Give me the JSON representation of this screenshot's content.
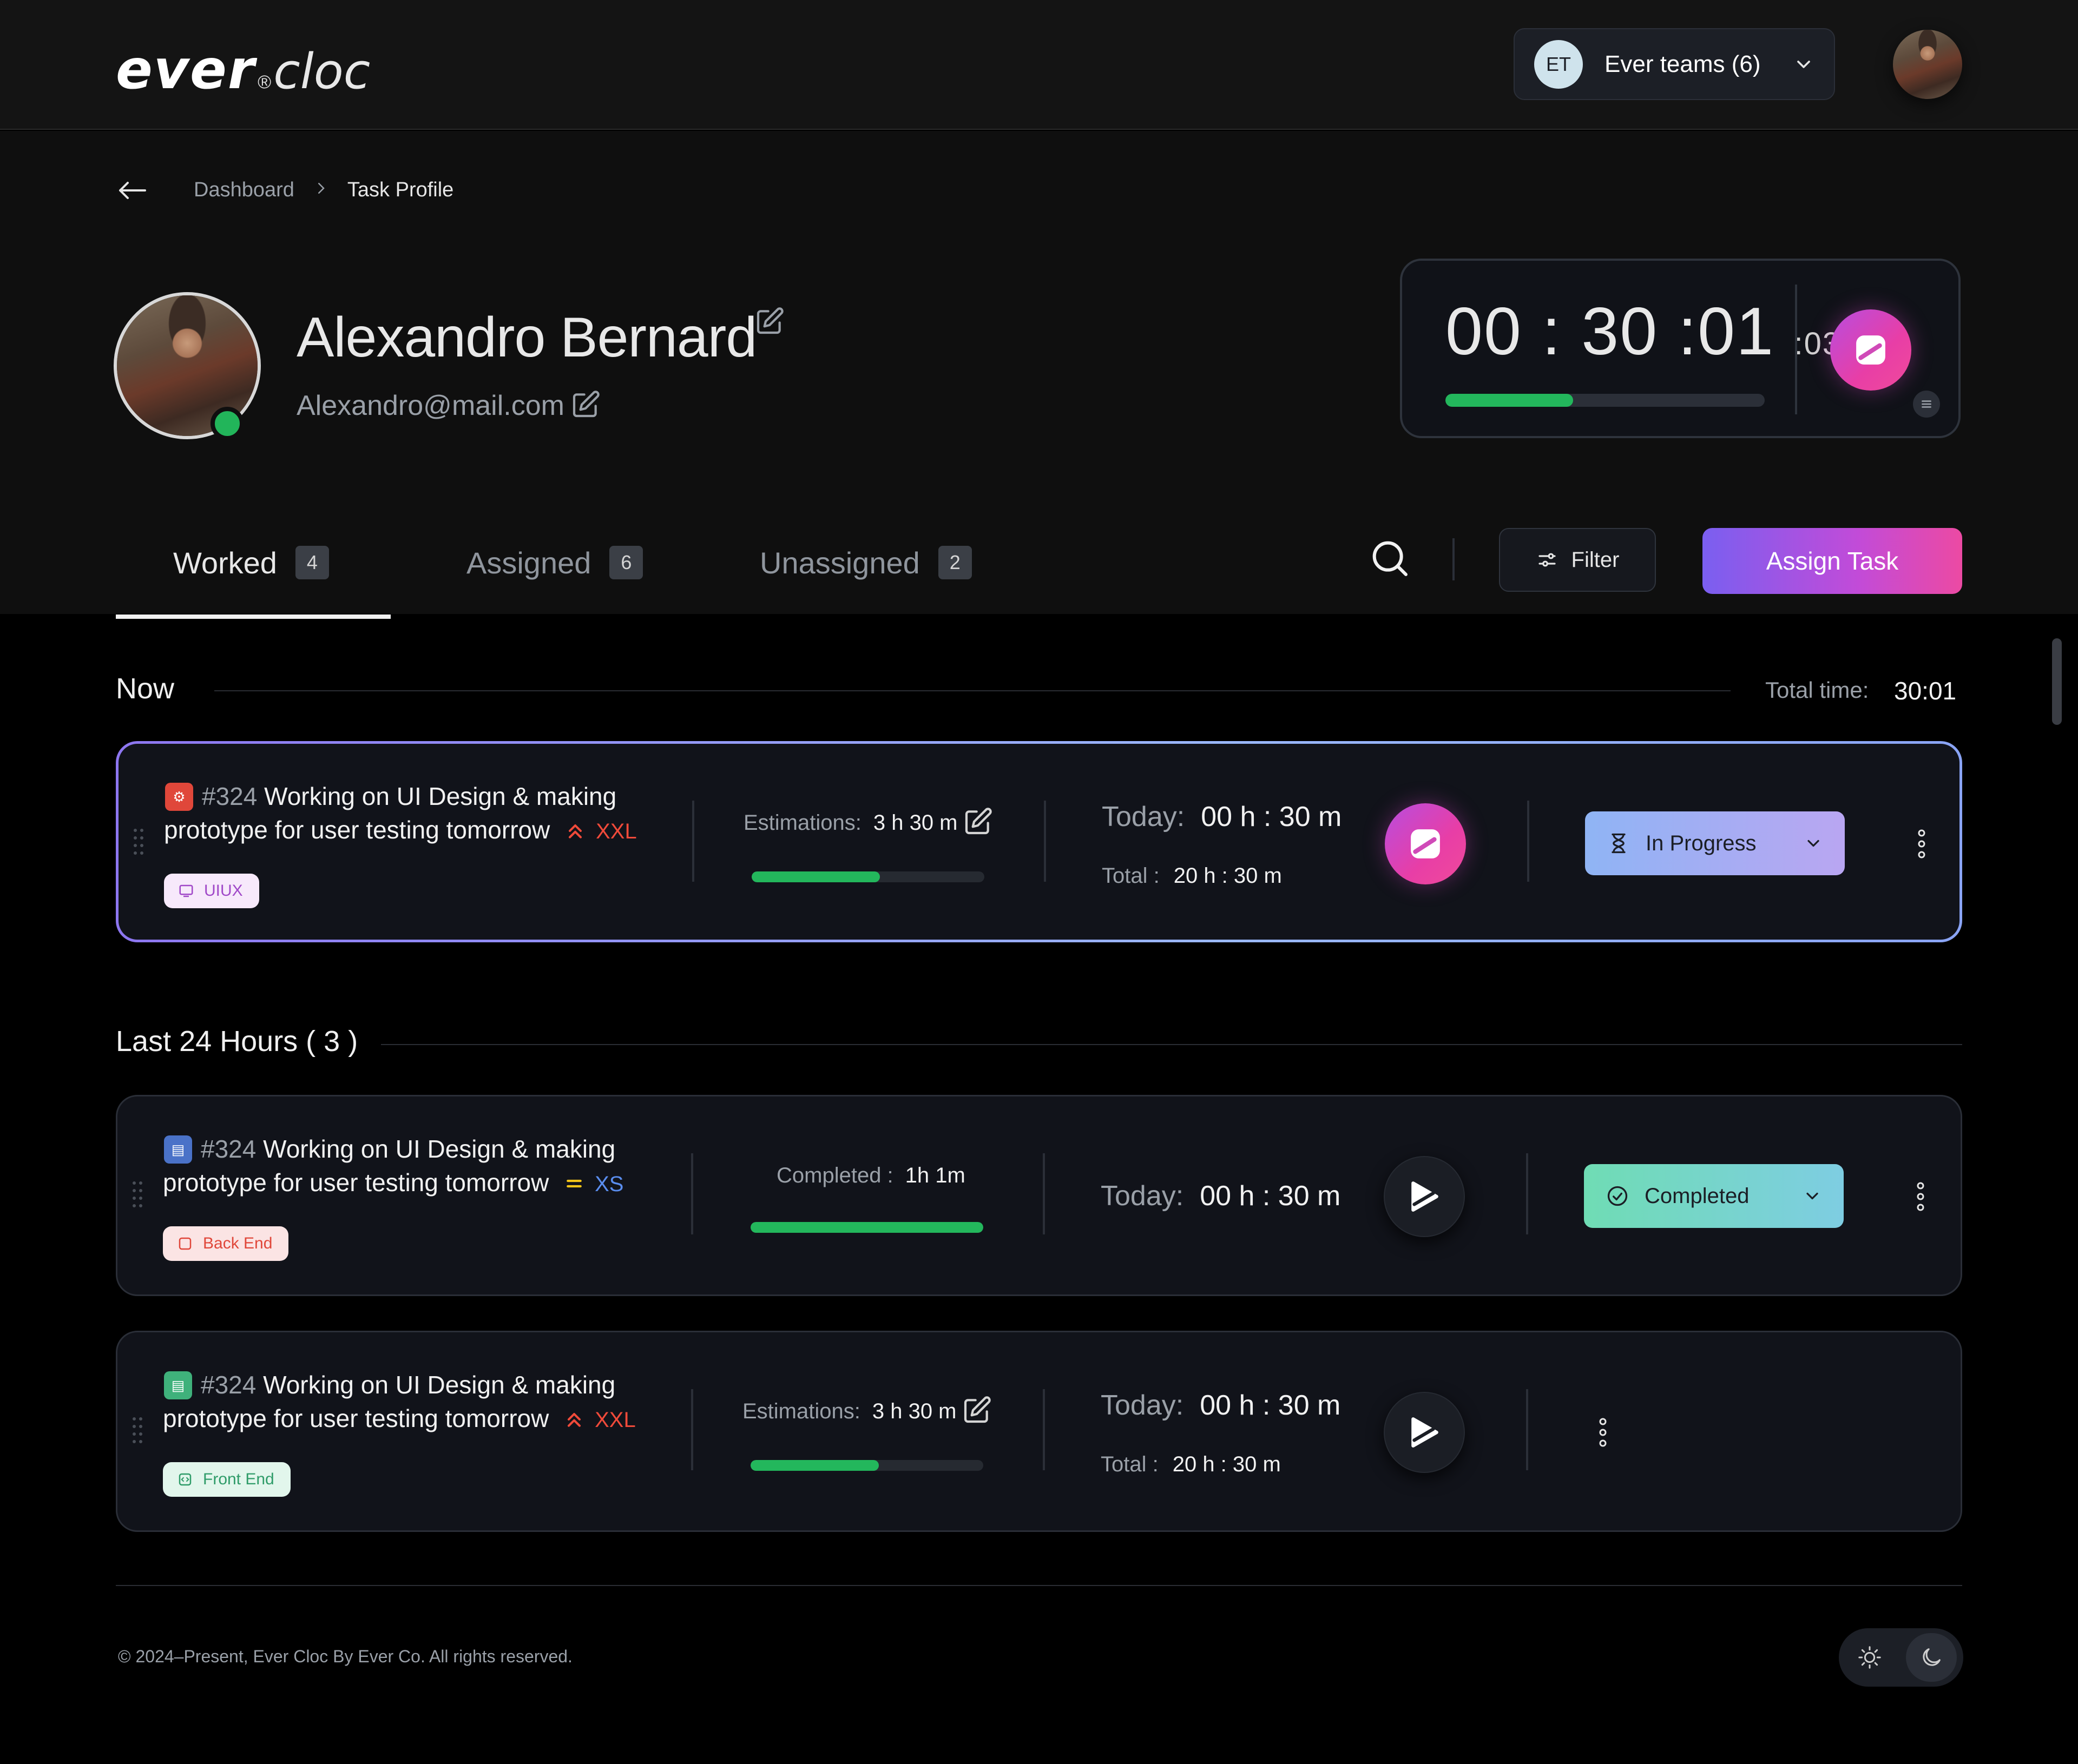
{
  "brand": {
    "logo_main": "ever",
    "logo_mark": "®",
    "logo_sub": "cloc"
  },
  "header": {
    "team_selector": {
      "initials": "ET",
      "label": "Ever teams (6)"
    }
  },
  "breadcrumb": {
    "items": [
      "Dashboard",
      "Task Profile"
    ]
  },
  "profile": {
    "name": "Alexandro Bernard",
    "email": "Alexandro@mail.com",
    "status": "online"
  },
  "timer": {
    "hh": "00",
    "mm": "30",
    "ss": "01",
    "ms": ":03",
    "sep": ":",
    "progress": 0.4
  },
  "tabs": [
    {
      "label": "Worked",
      "count": "4",
      "active": true
    },
    {
      "label": "Assigned",
      "count": "6",
      "active": false
    },
    {
      "label": "Unassigned",
      "count": "2",
      "active": false
    }
  ],
  "toolbar": {
    "filter_label": "Filter",
    "assign_label": "Assign Task"
  },
  "now_section": {
    "title": "Now",
    "total_label": "Total time:",
    "total_value": "30:01"
  },
  "last24_section": {
    "title": "Last 24 Hours ( 3 )"
  },
  "tasks": [
    {
      "number": "#324",
      "title": "Working on UI Design & making prototype for user testing tomorrow",
      "size": "XXL",
      "tag": "UIUX",
      "est_label": "Estimations:",
      "est_value": "3 h 30 m",
      "progress": 0.55,
      "today_label": "Today:",
      "today_value": "00 h : 30 m",
      "total_label": "Total :",
      "total_value": "20 h : 30 m",
      "status": "In Progress"
    },
    {
      "number": "#324",
      "title": "Working on UI Design & making prototype for user testing tomorrow",
      "size": "XS",
      "tag": "Back End",
      "est_label": "Completed :",
      "est_value": "1h 1m",
      "progress": 1.0,
      "today_label": "Today:",
      "today_value": "00 h : 30 m",
      "status": "Completed"
    },
    {
      "number": "#324",
      "title": "Working on UI Design & making prototype for user testing tomorrow",
      "size": "XXL",
      "tag": "Front End",
      "est_label": "Estimations:",
      "est_value": "3 h 30 m",
      "progress": 0.55,
      "today_label": "Today:",
      "today_value": "00 h : 30 m",
      "total_label": "Total :",
      "total_value": "20 h : 30 m"
    }
  ],
  "footer": {
    "copyright": "© 2024–Present, Ever Cloc By Ever Co. All rights reserved."
  },
  "colors": {
    "accent_green": "#23b75c",
    "assign_gradient_start": "#7a5ff0",
    "assign_gradient_end": "#ec4aa3",
    "priority_red": "#f04a3a",
    "priority_yellow": "#f5c518",
    "size_blue": "#5a8dee"
  }
}
